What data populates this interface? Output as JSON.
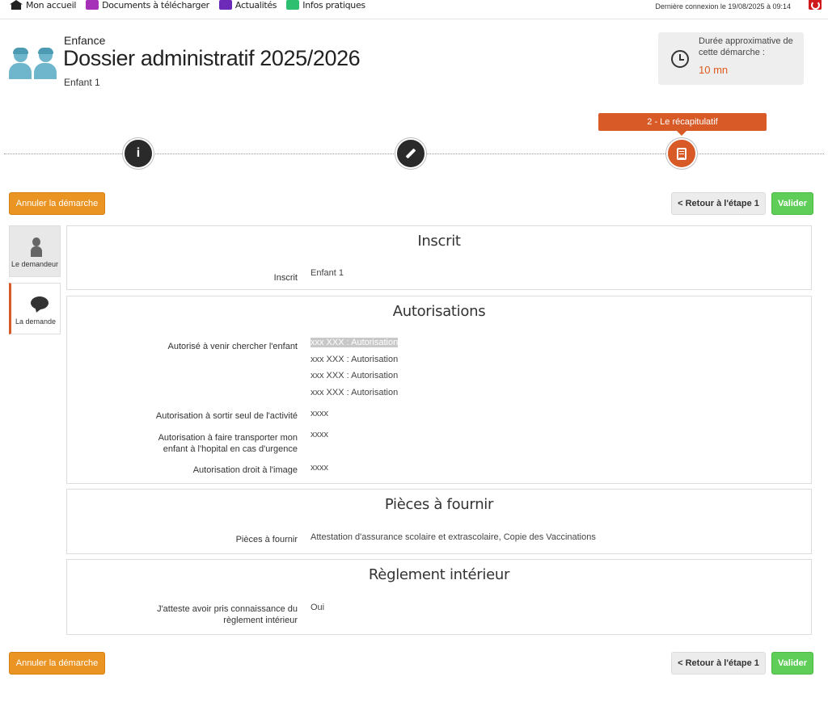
{
  "topnav": {
    "items": [
      {
        "label": "Mon accueil",
        "icon": "home-icon"
      },
      {
        "label": "Documents à télécharger",
        "icon": "documents-icon"
      },
      {
        "label": "Actualités",
        "icon": "news-icon"
      },
      {
        "label": "Infos pratiques",
        "icon": "info-icon"
      }
    ],
    "last_login": "Dernière connexion le 19/08/2025 à 09:14"
  },
  "header": {
    "section": "Enfance",
    "title": "Dossier administratif 2025/2026",
    "child": "Enfant 1"
  },
  "duration": {
    "label": "Durée approximative de cette démarche :",
    "value": "10 mn"
  },
  "stepper": {
    "active_label": "2 - Le récapitulatif",
    "active_step": 3
  },
  "buttons": {
    "cancel": "Annuler la démarche",
    "back": "< Retour à l'étape 1",
    "validate": "Valider"
  },
  "side_tabs": {
    "requester": "Le demandeur",
    "request": "La demande"
  },
  "panels": {
    "inscrit": {
      "title": "Inscrit",
      "fields": [
        {
          "label": "Inscrit",
          "value": "Enfant 1"
        }
      ]
    },
    "autorisations": {
      "title": "Autorisations",
      "pickup_label": "Autorisé à venir chercher l'enfant",
      "pickup_values": [
        "xxx XXX : Autorisation",
        "xxx XXX : Autorisation",
        "xxx XXX : Autorisation",
        "xxx XXX : Autorisation"
      ],
      "fields": [
        {
          "label": "Autorisation à sortir seul de l'activité",
          "value": "xxxx"
        },
        {
          "label": "Autorisation à faire transporter mon enfant à l'hopital en cas d'urgence",
          "value": "xxxx"
        },
        {
          "label": "Autorisation droit à l'image",
          "value": "xxxx"
        }
      ]
    },
    "pieces": {
      "title": "Pièces à fournir",
      "fields": [
        {
          "label": "Pièces à fournir",
          "value": "Attestation d'assurance scolaire et extrascolaire, Copie des Vaccinations"
        }
      ]
    },
    "reglement": {
      "title": "Règlement intérieur",
      "fields": [
        {
          "label": "J'atteste avoir pris connaissance du règlement intérieur",
          "value": "Oui"
        }
      ]
    }
  }
}
